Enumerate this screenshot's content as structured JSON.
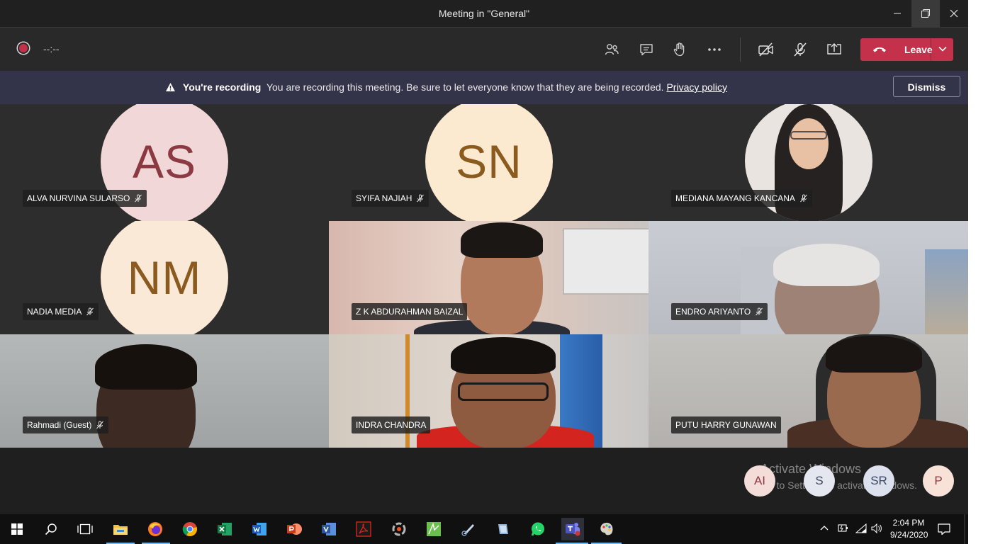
{
  "window": {
    "title": "Meeting in \"General\""
  },
  "meeting_bar": {
    "timer": "--:--",
    "leave_label": "Leave"
  },
  "banner": {
    "title": "You're recording",
    "message": "You are recording this meeting. Be sure to let everyone know that they are being recorded.",
    "link": "Privacy policy",
    "dismiss_label": "Dismiss"
  },
  "participants": [
    {
      "name": "ALVA NURVINA SULARSO",
      "initials": "AS",
      "muted": true,
      "avatar_bg": "#f2d7d9",
      "avatar_fg": "#8b3a42"
    },
    {
      "name": "SYIFA NAJIAH",
      "initials": "SN",
      "muted": true,
      "avatar_bg": "#fbe9d0",
      "avatar_fg": "#8a5a1e"
    },
    {
      "name": "MEDIANA MAYANG KANCANA",
      "muted": true
    },
    {
      "name": "NADIA MEDIA",
      "initials": "NM",
      "muted": true,
      "avatar_bg": "#fbe9d7",
      "avatar_fg": "#8a5a1e"
    },
    {
      "name": "Z K ABDURAHMAN BAIZAL",
      "muted": false
    },
    {
      "name": "ENDRO ARIYANTO",
      "muted": true
    },
    {
      "name": "Rahmadi (Guest)",
      "muted": true
    },
    {
      "name": "INDRA CHANDRA",
      "muted": false
    },
    {
      "name": "PUTU HARRY GUNAWAN",
      "muted": false
    }
  ],
  "overflow_avatars": [
    {
      "initials": "AI",
      "bg": "#f4dcd8",
      "fg": "#8b3a42"
    },
    {
      "initials": "S",
      "bg": "#e4e7ef",
      "fg": "#3a4660"
    },
    {
      "initials": "SR",
      "bg": "#dde1ee",
      "fg": "#3a4660"
    },
    {
      "initials": "P",
      "bg": "#f8e2d8",
      "fg": "#8b3a42"
    }
  ],
  "watermark": {
    "line1": "Activate Windows",
    "line2": "Go to Settings to activate Windows."
  },
  "taskbar": {
    "time": "2:04 PM",
    "date": "9/24/2020",
    "apps": [
      "file-explorer",
      "firefox",
      "chrome",
      "excel",
      "word",
      "powerpoint",
      "visio",
      "acrobat",
      "app-9",
      "app-10",
      "snipping",
      "app-12",
      "whatsapp",
      "teams",
      "paint"
    ]
  },
  "colors": {
    "leave_red": "#c4314b",
    "banner_bg": "#33344a",
    "app_bg": "#1f1f1f"
  }
}
